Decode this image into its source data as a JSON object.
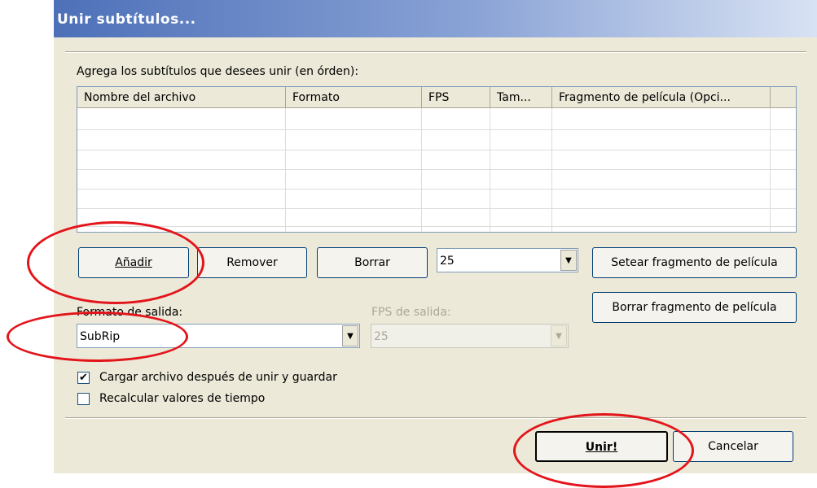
{
  "window": {
    "title": "Unir subtítulos..."
  },
  "list": {
    "label": "Agrega los subtítulos que desees unir (en órden):",
    "columns": [
      "Nombre del archivo",
      "Formato",
      "FPS",
      "Tam...",
      "Fragmento de película (Opci..."
    ]
  },
  "buttons": {
    "add": "Añadir",
    "remove": "Remover",
    "clear": "Borrar",
    "set_fragment": "Setear fragmento de película",
    "clear_fragment": "Borrar fragmento de película",
    "merge": "Unir!",
    "cancel": "Cancelar"
  },
  "fps_combo": {
    "value": "25"
  },
  "output_format": {
    "label": "Formato de salida:",
    "value": "SubRip"
  },
  "output_fps": {
    "label": "FPS de salida:",
    "value": "25"
  },
  "options": [
    {
      "label": "Cargar archivo después de unir y guardar",
      "checked": true
    },
    {
      "label": "Recalcular valores de tiempo",
      "checked": false
    }
  ],
  "colors": {
    "highlight_circle": "#e3141a",
    "title_bar": "#4d70b8"
  }
}
